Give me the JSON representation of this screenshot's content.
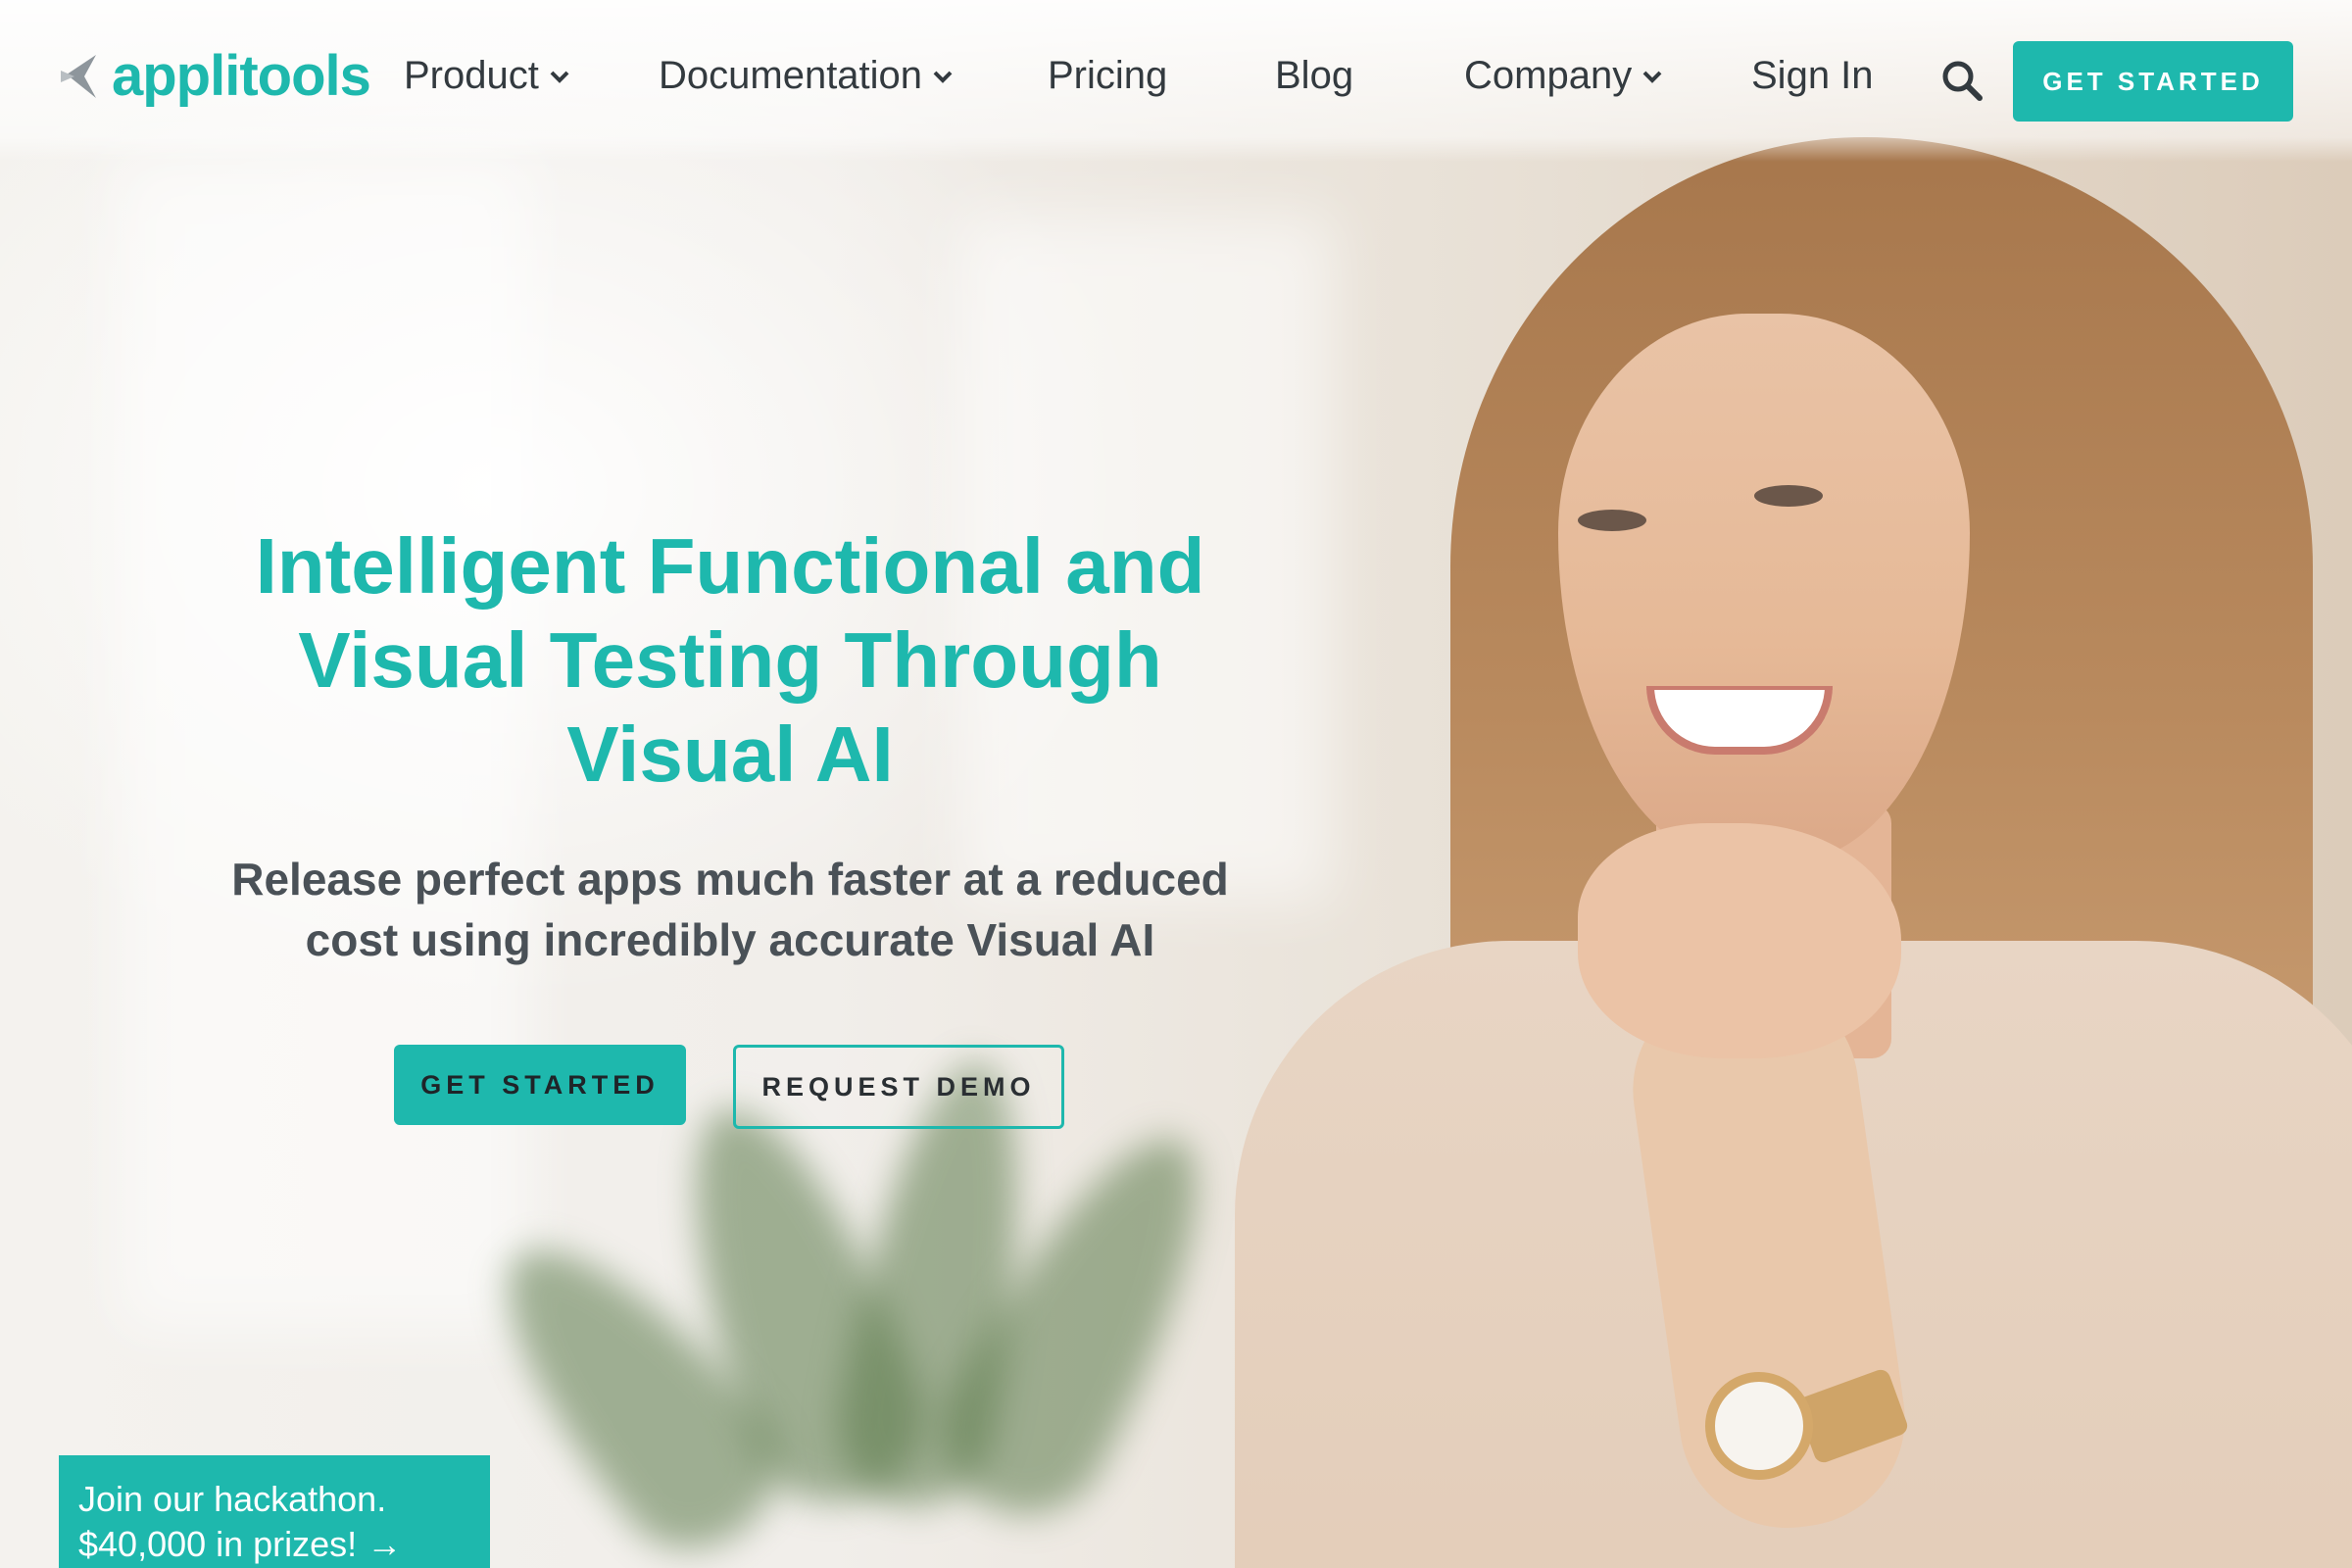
{
  "brand": {
    "name": "applitools",
    "accent_color": "#1eb8ad",
    "logo_icon": "applitools-logo-icon"
  },
  "nav": {
    "items": [
      {
        "label": "Product",
        "has_dropdown": true
      },
      {
        "label": "Documentation",
        "has_dropdown": true
      },
      {
        "label": "Pricing",
        "has_dropdown": false
      },
      {
        "label": "Blog",
        "has_dropdown": false
      },
      {
        "label": "Company",
        "has_dropdown": true
      },
      {
        "label": "Sign In",
        "has_dropdown": false
      }
    ],
    "search_icon": "search-icon",
    "cta_label": "GET STARTED"
  },
  "hero": {
    "title_line1": "Intelligent Functional and",
    "title_line2": "Visual Testing Through",
    "title_line3": "Visual AI",
    "subtitle_line1": "Release perfect apps much faster at a reduced",
    "subtitle_line2": "cost using incredibly accurate Visual AI",
    "primary_button": "GET STARTED",
    "secondary_button": "REQUEST DEMO"
  },
  "promo": {
    "line1": "Join our hackathon.",
    "line2": "$40,000 in prizes! →"
  }
}
